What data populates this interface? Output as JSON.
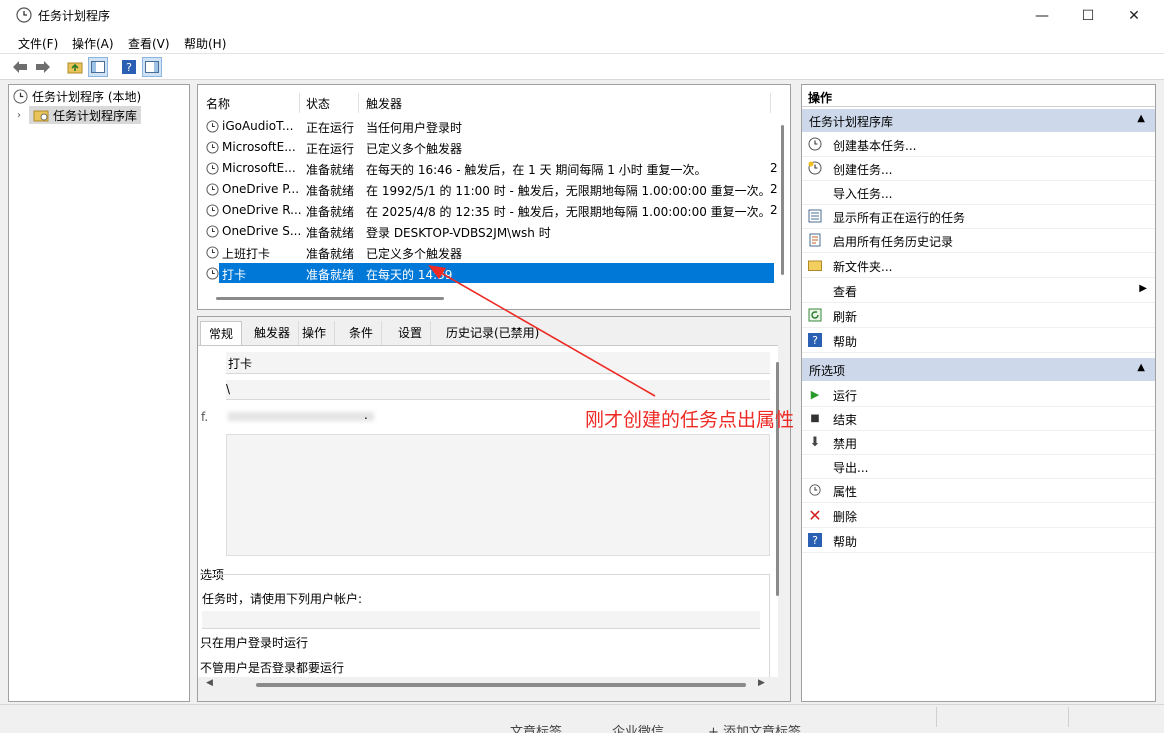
{
  "window": {
    "title": "任务计划程序",
    "minimize": "—",
    "maximize": "☐",
    "close": "✕"
  },
  "menu": [
    "文件(F)",
    "操作(A)",
    "查看(V)",
    "帮助(H)"
  ],
  "tree": {
    "root": "任务计划程序 (本地)",
    "child": "任务计划程序库"
  },
  "list": {
    "headers": [
      "名称",
      "状态",
      "触发器"
    ],
    "rows": [
      {
        "name": "iGoAudioT...",
        "status": "正在运行",
        "trigger": "当任何用户登录时"
      },
      {
        "name": "MicrosoftE...",
        "status": "正在运行",
        "trigger": "已定义多个触发器"
      },
      {
        "name": "MicrosoftE...",
        "status": "准备就绪",
        "trigger": "在每天的 16:46 - 触发后，在 1 天 期间每隔 1 小时 重复一次。",
        "tail": "2"
      },
      {
        "name": "OneDrive P...",
        "status": "准备就绪",
        "trigger": "在 1992/5/1 的 11:00 时 - 触发后，无限期地每隔 1.00:00:00 重复一次。",
        "tail": "2"
      },
      {
        "name": "OneDrive R...",
        "status": "准备就绪",
        "trigger": "在 2025/4/8 的 12:35 时 - 触发后，无限期地每隔 1.00:00:00 重复一次。",
        "tail": "2"
      },
      {
        "name": "OneDrive S...",
        "status": "准备就绪",
        "trigger": "登录 DESKTOP-VDBS2JM\\wsh 时"
      },
      {
        "name": "上班打卡",
        "status": "准备就绪",
        "trigger": "已定义多个触发器"
      }
    ],
    "selected": {
      "name": "打卡",
      "status": "准备就绪",
      "trigger": "在每天的 14:39"
    }
  },
  "tabs": [
    "常规",
    "触发器",
    "操作",
    "条件",
    "设置",
    "历史记录(已禁用)"
  ],
  "detail": {
    "name_value": "打卡",
    "location_value": "\\",
    "author_prefix": "f.",
    "author_suffix": ".",
    "security_label": "选项",
    "run_as_label": "任务时，请使用下列用户帐户:",
    "option1": "只在用户登录时运行",
    "option2": "不管用户是否登录都要运行",
    "option1_prefix": "只",
    "option2_prefix": "不"
  },
  "actions": {
    "title": "操作",
    "section1": "任务计划程序库",
    "items1": [
      "创建基本任务...",
      "创建任务...",
      "导入任务...",
      "显示所有正在运行的任务",
      "启用所有任务历史记录",
      "新文件夹...",
      "查看",
      "刷新",
      "帮助"
    ],
    "section2": "所选项",
    "items2": [
      "运行",
      "结束",
      "禁用",
      "导出...",
      "属性",
      "删除",
      "帮助"
    ]
  },
  "annotation": "刚才创建的任务点出属性",
  "bottom_tabs": [
    "文章标签",
    "企业微信",
    "+ 添加文章标签"
  ],
  "colors": {
    "selection": "#0078d7",
    "section_bg": "#cdd9ea",
    "annotation": "#ee2a24"
  }
}
